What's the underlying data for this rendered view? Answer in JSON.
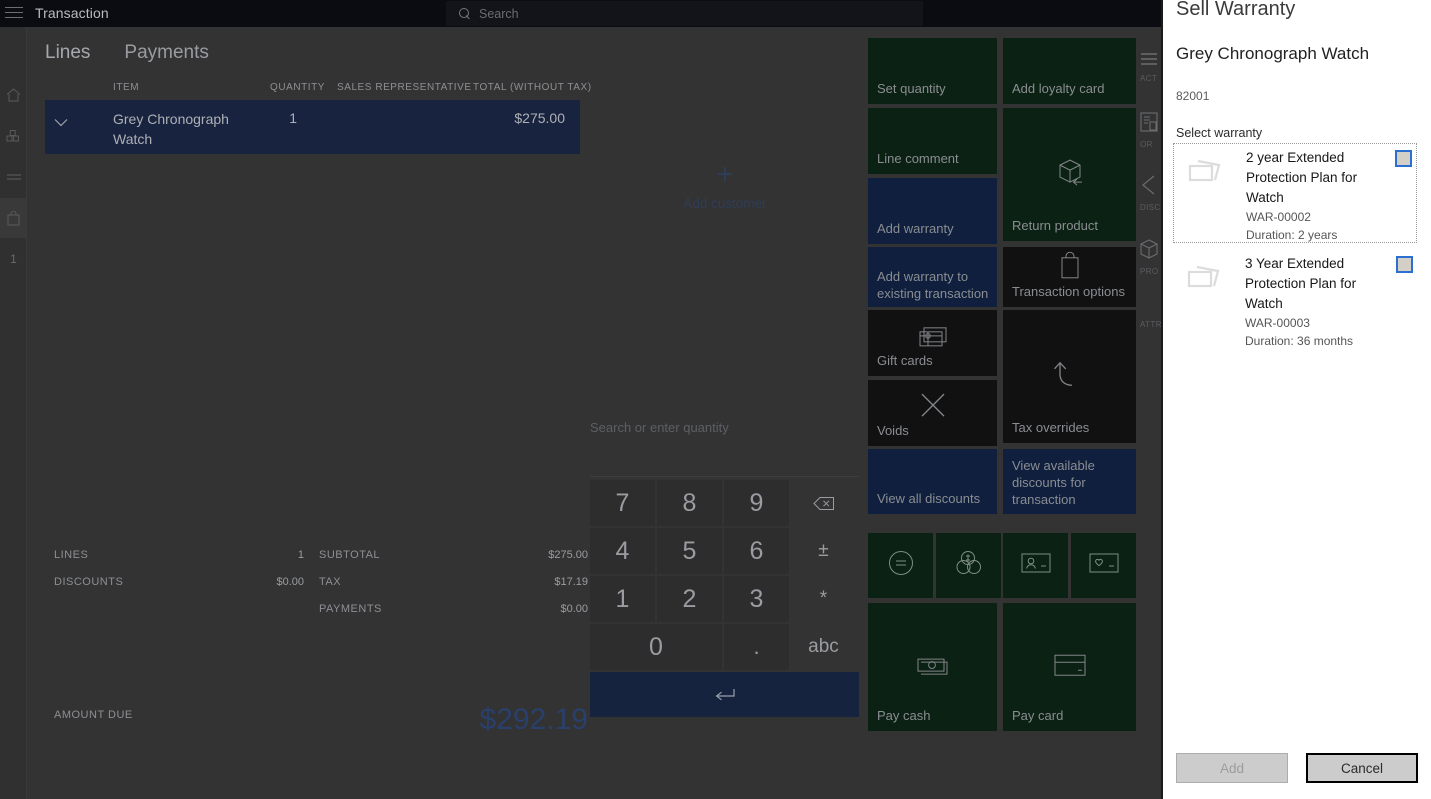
{
  "app": {
    "title": "Transaction",
    "menu_icon": "hamburger-icon",
    "search": {
      "placeholder": "Search",
      "icon": "search-icon"
    }
  },
  "left_rail": {
    "items": [
      {
        "name": "home",
        "icon": "home-icon"
      },
      {
        "name": "products",
        "icon": "cubes-icon"
      },
      {
        "name": "lines",
        "icon": "lines-icon"
      },
      {
        "name": "cart",
        "icon": "bag-icon"
      }
    ],
    "badge": "1"
  },
  "transaction": {
    "tabs": [
      {
        "label": "Lines",
        "active": true
      },
      {
        "label": "Payments",
        "active": false
      }
    ],
    "columns": [
      "ITEM",
      "QUANTITY",
      "SALES REPRESENTATIVE",
      "TOTAL (WITHOUT TAX)"
    ],
    "rows": [
      {
        "item": "Grey Chronograph Watch",
        "quantity": "1",
        "rep": "",
        "total": "$275.00",
        "selected": true
      }
    ],
    "add_customer": {
      "label": "Add customer",
      "icon": "plus-icon"
    },
    "totals_left": [
      {
        "key": "LINES",
        "value": "1"
      },
      {
        "key": "DISCOUNTS",
        "value": "$0.00"
      }
    ],
    "totals_right": [
      {
        "key": "SUBTOTAL",
        "value": "$275.00"
      },
      {
        "key": "TAX",
        "value": "$17.19"
      },
      {
        "key": "PAYMENTS",
        "value": "$0.00"
      }
    ],
    "amount_due": {
      "label": "AMOUNT DUE",
      "value": "$292.19"
    }
  },
  "numpad": {
    "hint": "Search or enter quantity",
    "keys": [
      "7",
      "8",
      "9",
      "4",
      "5",
      "6",
      "1",
      "2",
      "3",
      "0",
      "."
    ],
    "backspace_icon": "backspace-icon",
    "plusminus": "±",
    "asterisk": "*",
    "abc": "abc",
    "enter_icon": "enter-icon"
  },
  "tiles": [
    {
      "label": "Set quantity",
      "color": "green",
      "icon": ""
    },
    {
      "label": "Add loyalty card",
      "color": "green",
      "icon": ""
    },
    {
      "label": "Line comment",
      "color": "green",
      "icon": ""
    },
    {
      "label": "Return product",
      "color": "green",
      "icon": "return-box-icon"
    },
    {
      "label": "Add warranty",
      "color": "blue",
      "icon": ""
    },
    {
      "label": "Add warranty to existing transaction",
      "color": "blue",
      "icon": ""
    },
    {
      "label": "Transaction options",
      "color": "black",
      "icon": "bag-icon"
    },
    {
      "label": "Gift cards",
      "color": "black",
      "icon": "gift-card-icon"
    },
    {
      "label": "Tax overrides",
      "color": "black",
      "icon": "undo-icon"
    },
    {
      "label": "Voids",
      "color": "black",
      "icon": "close-x-icon"
    },
    {
      "label": "View all discounts",
      "color": "blue",
      "icon": ""
    },
    {
      "label": "View available discounts for transaction",
      "color": "blue",
      "icon": ""
    }
  ],
  "small_tiles": [
    {
      "icon": "price-check-icon",
      "color": "green"
    },
    {
      "icon": "coins-icon",
      "color": "green"
    },
    {
      "icon": "customer-card-icon",
      "color": "green"
    },
    {
      "icon": "loyalty-card-icon",
      "color": "green"
    }
  ],
  "pay_tiles": [
    {
      "label": "Pay cash",
      "icon": "cash-icon",
      "color": "green"
    },
    {
      "label": "Pay card",
      "icon": "credit-card-icon",
      "color": "green"
    }
  ],
  "right_rail": [
    {
      "caption": "ACT",
      "icon": "menu-icon"
    },
    {
      "caption": "OR",
      "icon": "order-icon"
    },
    {
      "caption": "DISC",
      "icon": "discount-tag-icon"
    },
    {
      "caption": "PRO",
      "icon": "product-cube-icon"
    },
    {
      "caption": "ATTR",
      "icon": ""
    }
  ],
  "panel": {
    "title": "Sell Warranty",
    "product_name": "Grey Chronograph Watch",
    "product_id": "82001",
    "select_label": "Select warranty",
    "warranties": [
      {
        "name": "2 year Extended Protection Plan for Watch",
        "code": "WAR-00002",
        "duration": "Duration: 2 years",
        "checked": false,
        "focused": true,
        "icon": "folder-icon"
      },
      {
        "name": "3 Year Extended Protection Plan for Watch",
        "code": "WAR-00003",
        "duration": "Duration: 36 months",
        "checked": false,
        "focused": false,
        "icon": "folder-icon"
      }
    ],
    "buttons": {
      "add": "Add",
      "cancel": "Cancel"
    },
    "accent_color": "#2b6fd0"
  }
}
